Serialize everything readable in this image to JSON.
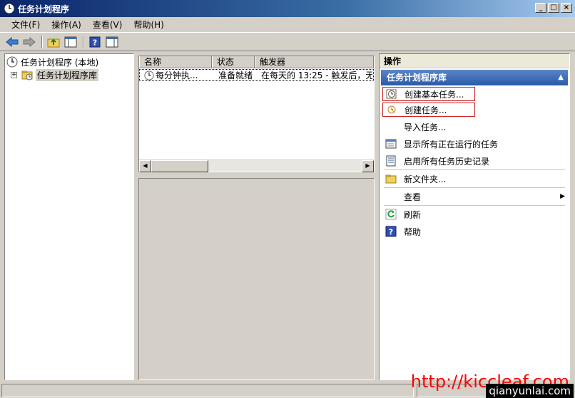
{
  "window": {
    "title": "任务计划程序"
  },
  "menubar": [
    "文件(F)",
    "操作(A)",
    "查看(V)",
    "帮助(H)"
  ],
  "tree": {
    "root": "任务计划程序 (本地)",
    "library": "任务计划程序库"
  },
  "list": {
    "headers": [
      "名称",
      "状态",
      "触发器"
    ],
    "rows": [
      {
        "name": "每分钟执...",
        "status": "准备就绪",
        "trigger": "在每天的 13:25 - 触发后，无"
      }
    ]
  },
  "actions": {
    "header": "操作",
    "section": "任务计划程序库",
    "items": [
      {
        "label": "创建基本任务...",
        "icon": "create-basic-task-icon"
      },
      {
        "label": "创建任务...",
        "icon": "create-task-icon"
      },
      {
        "label": "导入任务...",
        "icon": ""
      },
      {
        "label": "显示所有正在运行的任务",
        "icon": "running-tasks-icon"
      },
      {
        "label": "启用所有任务历史记录",
        "icon": "history-icon"
      },
      {
        "label": "新文件夹...",
        "icon": "folder-icon"
      },
      {
        "label": "查看",
        "icon": ""
      },
      {
        "label": "刷新",
        "icon": "refresh-icon"
      },
      {
        "label": "帮助",
        "icon": "help-icon"
      }
    ]
  },
  "watermark": {
    "text1": "http://kiccleaf.com",
    "text2": "qianyunlai.com"
  }
}
